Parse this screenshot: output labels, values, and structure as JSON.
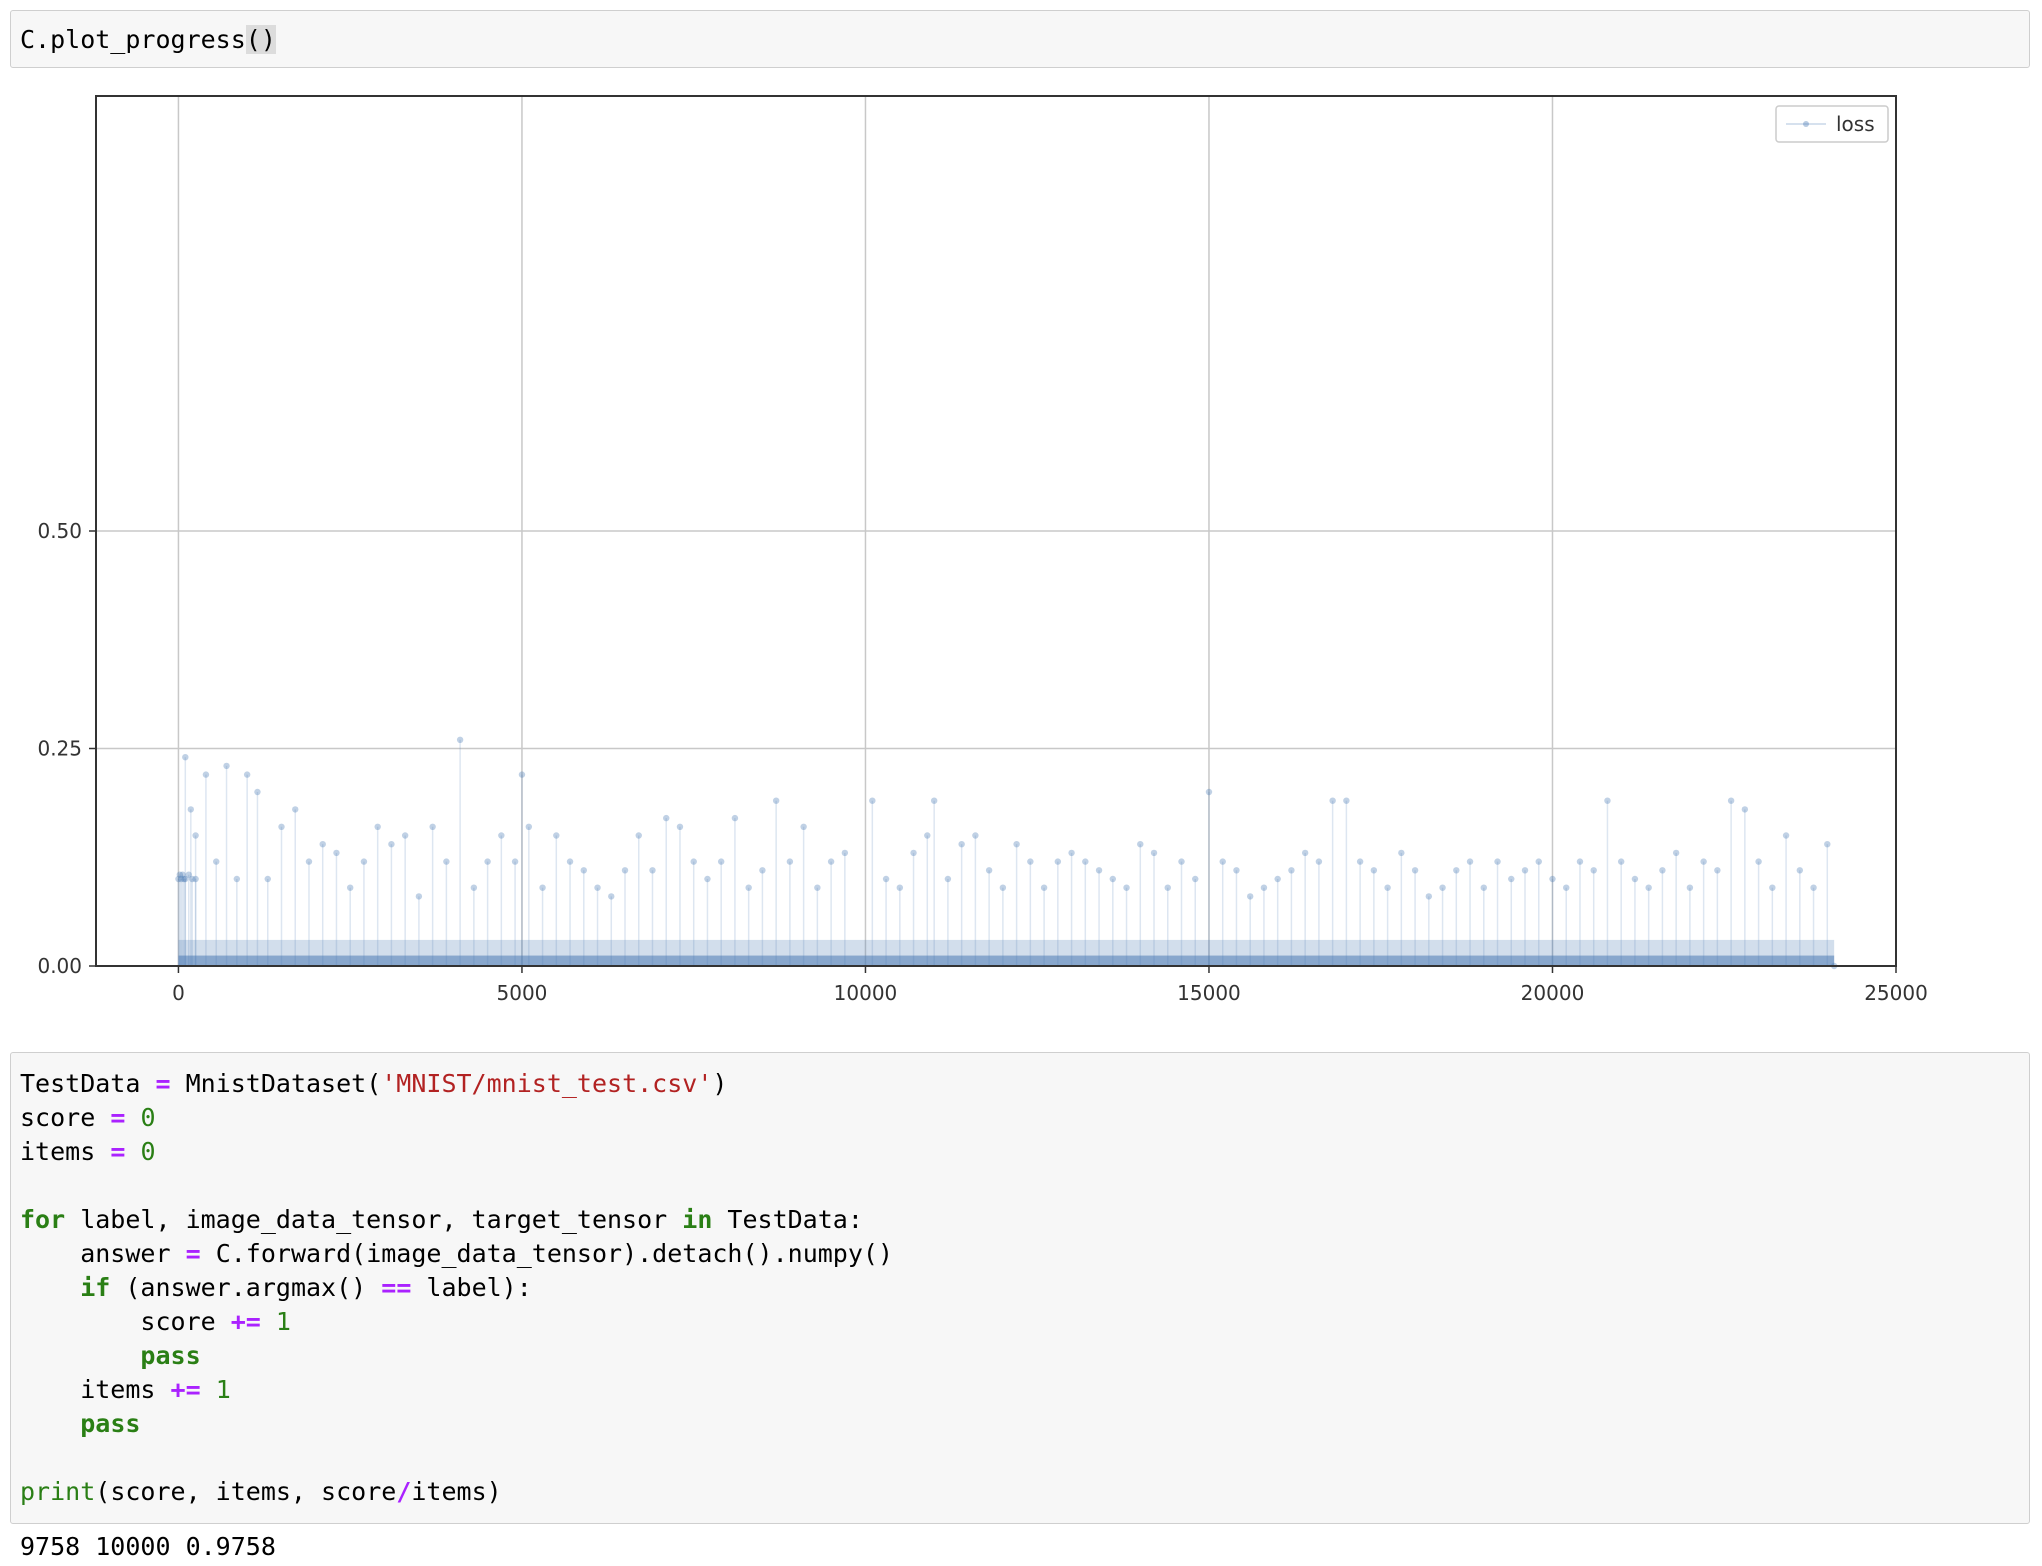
{
  "cell1": {
    "code_prefix": "C.plot_progress",
    "code_parens": "()"
  },
  "chart_data": {
    "type": "scatter",
    "title": "",
    "xlabel": "",
    "ylabel": "",
    "xlim": [
      -1200,
      25000
    ],
    "ylim": [
      0,
      1.0
    ],
    "x_ticks": [
      0,
      5000,
      10000,
      15000,
      20000,
      25000
    ],
    "x_tick_labels": [
      "0",
      "5000",
      "10000",
      "15000",
      "20000",
      "25000"
    ],
    "y_ticks": [
      0.0,
      0.25,
      0.5
    ],
    "y_tick_labels": [
      "0.00",
      "0.25",
      "0.50"
    ],
    "grid": true,
    "legend": {
      "position": "top-right",
      "entries": [
        "loss"
      ]
    },
    "series": [
      {
        "name": "loss",
        "color": "#4a7ab5",
        "marker": "point",
        "linestyle": "solid",
        "alpha": 0.15,
        "points": [
          [
            0,
            0.1
          ],
          [
            20,
            0.105
          ],
          [
            40,
            0.1
          ],
          [
            60,
            0.105
          ],
          [
            80,
            0.1
          ],
          [
            100,
            0.1
          ],
          [
            150,
            0.105
          ],
          [
            200,
            0.1
          ],
          [
            250,
            0.1
          ],
          [
            100,
            0.24
          ],
          [
            180,
            0.18
          ],
          [
            250,
            0.15
          ],
          [
            400,
            0.22
          ],
          [
            550,
            0.12
          ],
          [
            700,
            0.23
          ],
          [
            850,
            0.1
          ],
          [
            1000,
            0.22
          ],
          [
            1150,
            0.2
          ],
          [
            1300,
            0.1
          ],
          [
            1500,
            0.16
          ],
          [
            1700,
            0.18
          ],
          [
            1900,
            0.12
          ],
          [
            2100,
            0.14
          ],
          [
            2300,
            0.13
          ],
          [
            2500,
            0.09
          ],
          [
            2700,
            0.12
          ],
          [
            2900,
            0.16
          ],
          [
            3100,
            0.14
          ],
          [
            3300,
            0.15
          ],
          [
            3500,
            0.08
          ],
          [
            3700,
            0.16
          ],
          [
            3900,
            0.12
          ],
          [
            4100,
            0.26
          ],
          [
            4300,
            0.09
          ],
          [
            4500,
            0.12
          ],
          [
            4700,
            0.15
          ],
          [
            4900,
            0.12
          ],
          [
            5000,
            0.22
          ],
          [
            5100,
            0.16
          ],
          [
            5300,
            0.09
          ],
          [
            5500,
            0.15
          ],
          [
            5700,
            0.12
          ],
          [
            5900,
            0.11
          ],
          [
            6100,
            0.09
          ],
          [
            6300,
            0.08
          ],
          [
            6500,
            0.11
          ],
          [
            6700,
            0.15
          ],
          [
            6900,
            0.11
          ],
          [
            7100,
            0.17
          ],
          [
            7300,
            0.16
          ],
          [
            7500,
            0.12
          ],
          [
            7700,
            0.1
          ],
          [
            7900,
            0.12
          ],
          [
            8100,
            0.17
          ],
          [
            8300,
            0.09
          ],
          [
            8500,
            0.11
          ],
          [
            8700,
            0.19
          ],
          [
            8900,
            0.12
          ],
          [
            9100,
            0.16
          ],
          [
            9300,
            0.09
          ],
          [
            9500,
            0.12
          ],
          [
            9700,
            0.13
          ],
          [
            10100,
            0.19
          ],
          [
            10300,
            0.1
          ],
          [
            10500,
            0.09
          ],
          [
            10700,
            0.13
          ],
          [
            10900,
            0.15
          ],
          [
            11000,
            0.19
          ],
          [
            11200,
            0.1
          ],
          [
            11400,
            0.14
          ],
          [
            11600,
            0.15
          ],
          [
            11800,
            0.11
          ],
          [
            12000,
            0.09
          ],
          [
            12200,
            0.14
          ],
          [
            12400,
            0.12
          ],
          [
            12600,
            0.09
          ],
          [
            12800,
            0.12
          ],
          [
            13000,
            0.13
          ],
          [
            13200,
            0.12
          ],
          [
            13400,
            0.11
          ],
          [
            13600,
            0.1
          ],
          [
            13800,
            0.09
          ],
          [
            14000,
            0.14
          ],
          [
            14200,
            0.13
          ],
          [
            14400,
            0.09
          ],
          [
            14600,
            0.12
          ],
          [
            14800,
            0.1
          ],
          [
            15000,
            0.2
          ],
          [
            15200,
            0.12
          ],
          [
            15400,
            0.11
          ],
          [
            15600,
            0.08
          ],
          [
            15800,
            0.09
          ],
          [
            16000,
            0.1
          ],
          [
            16200,
            0.11
          ],
          [
            16400,
            0.13
          ],
          [
            16600,
            0.12
          ],
          [
            16800,
            0.19
          ],
          [
            17000,
            0.19
          ],
          [
            17200,
            0.12
          ],
          [
            17400,
            0.11
          ],
          [
            17600,
            0.09
          ],
          [
            17800,
            0.13
          ],
          [
            18000,
            0.11
          ],
          [
            18200,
            0.08
          ],
          [
            18400,
            0.09
          ],
          [
            18600,
            0.11
          ],
          [
            18800,
            0.12
          ],
          [
            19000,
            0.09
          ],
          [
            19200,
            0.12
          ],
          [
            19400,
            0.1
          ],
          [
            19600,
            0.11
          ],
          [
            19800,
            0.12
          ],
          [
            20000,
            0.1
          ],
          [
            20200,
            0.09
          ],
          [
            20400,
            0.12
          ],
          [
            20600,
            0.11
          ],
          [
            20800,
            0.19
          ],
          [
            21000,
            0.12
          ],
          [
            21200,
            0.1
          ],
          [
            21400,
            0.09
          ],
          [
            21600,
            0.11
          ],
          [
            21800,
            0.13
          ],
          [
            22000,
            0.09
          ],
          [
            22200,
            0.12
          ],
          [
            22400,
            0.11
          ],
          [
            22600,
            0.19
          ],
          [
            22800,
            0.18
          ],
          [
            23000,
            0.12
          ],
          [
            23200,
            0.09
          ],
          [
            23400,
            0.15
          ],
          [
            23600,
            0.11
          ],
          [
            23800,
            0.09
          ],
          [
            24000,
            0.14
          ],
          [
            24100,
            0.0
          ]
        ]
      }
    ]
  },
  "cell2": {
    "lines": [
      [
        {
          "t": "TestData "
        },
        {
          "t": "=",
          "c": "op"
        },
        {
          "t": " MnistDataset("
        },
        {
          "t": "'MNIST/mnist_test.csv'",
          "c": "str"
        },
        {
          "t": ")"
        }
      ],
      [
        {
          "t": "score "
        },
        {
          "t": "=",
          "c": "op"
        },
        {
          "t": " "
        },
        {
          "t": "0",
          "c": "num"
        }
      ],
      [
        {
          "t": "items "
        },
        {
          "t": "=",
          "c": "op"
        },
        {
          "t": " "
        },
        {
          "t": "0",
          "c": "num"
        }
      ],
      [],
      [
        {
          "t": "for",
          "c": "kw"
        },
        {
          "t": " label, image_data_tensor, target_tensor "
        },
        {
          "t": "in",
          "c": "kw"
        },
        {
          "t": " TestData:"
        }
      ],
      [
        {
          "t": "    answer "
        },
        {
          "t": "=",
          "c": "op"
        },
        {
          "t": " C.forward(image_data_tensor).detach().numpy()"
        }
      ],
      [
        {
          "t": "    "
        },
        {
          "t": "if",
          "c": "kw"
        },
        {
          "t": " (answer.argmax() "
        },
        {
          "t": "==",
          "c": "op"
        },
        {
          "t": " label):"
        }
      ],
      [
        {
          "t": "        score "
        },
        {
          "t": "+=",
          "c": "op"
        },
        {
          "t": " "
        },
        {
          "t": "1",
          "c": "num"
        }
      ],
      [
        {
          "t": "        "
        },
        {
          "t": "pass",
          "c": "kw"
        }
      ],
      [
        {
          "t": "    items "
        },
        {
          "t": "+=",
          "c": "op"
        },
        {
          "t": " "
        },
        {
          "t": "1",
          "c": "num"
        }
      ],
      [
        {
          "t": "    "
        },
        {
          "t": "pass",
          "c": "kw"
        }
      ],
      [],
      [
        {
          "t": "print",
          "c": "bi"
        },
        {
          "t": "(score, items, score"
        },
        {
          "t": "/",
          "c": "op"
        },
        {
          "t": "items)"
        }
      ]
    ]
  },
  "output": {
    "text": "9758 10000 0.9758"
  }
}
